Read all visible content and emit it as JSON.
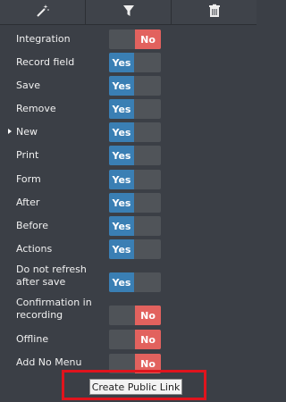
{
  "toolbar": {
    "buttons": [
      {
        "icon": "magic-wand-icon"
      },
      {
        "icon": "filter-icon"
      },
      {
        "icon": "trash-icon"
      }
    ]
  },
  "settings": [
    {
      "label": "Integration",
      "value": "No"
    },
    {
      "label": "Record field",
      "value": "Yes"
    },
    {
      "label": "Save",
      "value": "Yes"
    },
    {
      "label": "Remove",
      "value": "Yes"
    },
    {
      "label": "New",
      "value": "Yes",
      "selected": true
    },
    {
      "label": "Print",
      "value": "Yes"
    },
    {
      "label": "Form",
      "value": "Yes"
    },
    {
      "label": "After",
      "value": "Yes"
    },
    {
      "label": "Before",
      "value": "Yes"
    },
    {
      "label": "Actions",
      "value": "Yes"
    },
    {
      "label": "Do not refresh after save",
      "value": "Yes"
    },
    {
      "label": "Confirmation in recording",
      "value": "No"
    },
    {
      "label": "Offline",
      "value": "No"
    },
    {
      "label": "Add No Menu",
      "value": "No"
    }
  ],
  "create_public_link_label": "Create Public Link",
  "colors": {
    "background": "#3b3f46",
    "yes": "#3a7fb4",
    "no": "#e2625e",
    "highlight": "#e0141d"
  }
}
